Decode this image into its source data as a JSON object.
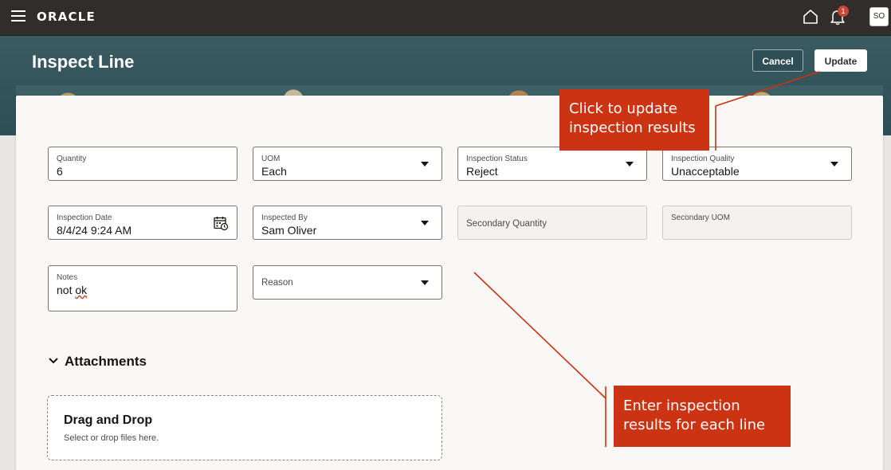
{
  "topbar": {
    "brand": "ORACLE",
    "notification_count": "1",
    "avatar_initials": "SO"
  },
  "header": {
    "title": "Inspect Line",
    "cancel_label": "Cancel",
    "update_label": "Update"
  },
  "form": {
    "quantity": {
      "label": "Quantity",
      "value": "6"
    },
    "uom": {
      "label": "UOM",
      "value": "Each"
    },
    "inspection_status": {
      "label": "Inspection Status",
      "value": "Reject"
    },
    "inspection_quality": {
      "label": "Inspection Quality",
      "value": "Unacceptable"
    },
    "inspection_date": {
      "label": "Inspection Date",
      "value": "8/4/24 9:24 AM"
    },
    "inspected_by": {
      "label": "Inspected By",
      "value": "Sam Oliver"
    },
    "secondary_quantity": {
      "label": "Secondary Quantity"
    },
    "secondary_uom": {
      "label": "Secondary UOM"
    },
    "notes": {
      "label": "Notes",
      "value_prefix": "not ",
      "value_misspelled": "ok"
    },
    "reason": {
      "label": "Reason"
    }
  },
  "attachments": {
    "title": "Attachments",
    "drop_title": "Drag and Drop",
    "drop_subtitle": "Select or drop files here."
  },
  "annotations": {
    "update_callout": [
      "Click to update",
      "inspection results"
    ],
    "enter_callout": [
      "Enter inspection",
      "results for each line"
    ]
  },
  "colors": {
    "topbar": "#312d2a",
    "header": "#2e4e56",
    "callout": "#cc3312",
    "badge": "#c74634"
  }
}
